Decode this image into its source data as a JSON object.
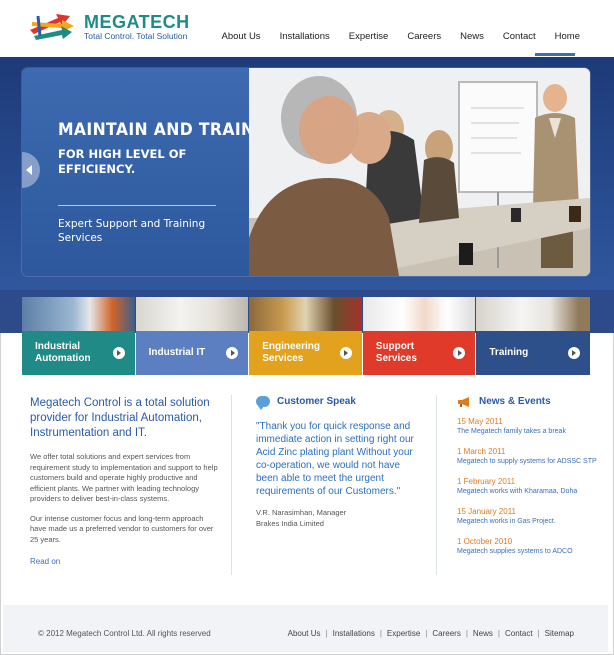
{
  "brand": {
    "name": "MEGATECH",
    "tagline": "Total Control. Total Solution"
  },
  "nav": {
    "items": [
      "About Us",
      "Installations",
      "Expertise",
      "Careers",
      "News",
      "Contact",
      "Home"
    ],
    "active": "Home"
  },
  "hero": {
    "heading": "MAINTAIN AND TRAIN.",
    "subheading": "FOR HIGH LEVEL OF EFFICIENCY.",
    "description": "Expert Support and Training Services"
  },
  "tiles": [
    {
      "label": "Industrial Automation",
      "color": "#1f8a86"
    },
    {
      "label": "Industrial IT",
      "color": "#5b7fc0"
    },
    {
      "label": "Engineering Services",
      "color": "#e3a21e"
    },
    {
      "label": "Support Services",
      "color": "#e03a2a"
    },
    {
      "label": "Training",
      "color": "#2d4f8a"
    }
  ],
  "about": {
    "intro": "Megatech Control is a total solution provider for Industrial Automation, Instrumentation and IT.",
    "paragraph1": "We offer total solutions and expert services from requirement study to implementation and support to help customers build and operate highly productive and efficient plants. We partner with leading technology providers to deliver best-in-class systems.",
    "paragraph2": "Our intense customer focus and long-term approach have made us a preferred vendor to customers for over 25 years.",
    "read_on": "Read on"
  },
  "customer_speak": {
    "title": "Customer Speak",
    "quote": "\"Thank you for quick response and immediate action in setting right our Acid Zinc plating plant Without your co-operation, we would not have been able to meet the urgent requirements of our Customers.\"",
    "author_name": "V.R. Narasimhan, Manager",
    "author_company": "Brakes India Limited"
  },
  "news": {
    "title": "News & Events",
    "items": [
      {
        "date": "15 May 2011",
        "text": "The Megatech family takes a break"
      },
      {
        "date": "1 March 2011",
        "text": "Megatech to supply systems for ADSSC STP"
      },
      {
        "date": "1 February 2011",
        "text": "Megatech works with Kharamaa, Doha"
      },
      {
        "date": "15 January 2011",
        "text": "Megatech works in Gas Project."
      },
      {
        "date": "1 October 2010",
        "text": "Megatech supplies systems to ADCO"
      }
    ]
  },
  "footer": {
    "copyright": "© 2012 Megatech Control Ltd. All rights reserved",
    "links": [
      "About Us",
      "Installations",
      "Expertise",
      "Careers",
      "News",
      "Contact",
      "Sitemap"
    ]
  }
}
